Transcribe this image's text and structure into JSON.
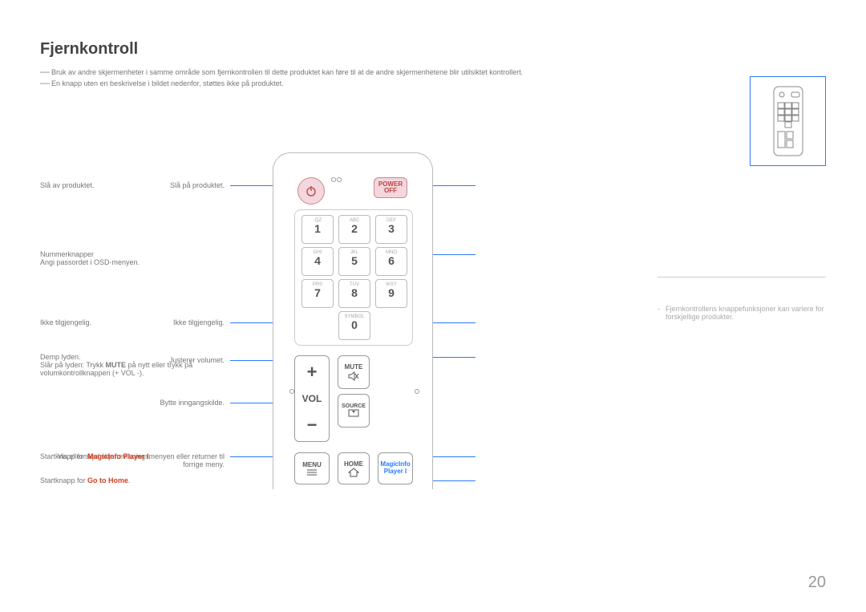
{
  "title": "Fjernkontroll",
  "note1": "Bruk av andre skjermenheter i samme område som fjernkontrollen til dette produktet kan føre til at de andre skjermenhetene blir utilsiktet kontrollert.",
  "note2": "En knapp uten en beskrivelse i bildet nedenfor, støttes ikke på produktet.",
  "sidenote": "Fjernkontrollens knappefunksjoner kan variere for forskjellige produkter.",
  "pagenum": "20",
  "remote": {
    "poweroff": "POWER OFF",
    "vol": "VOL",
    "mute": "MUTE",
    "source": "SOURCE",
    "menu": "MENU",
    "home": "HOME",
    "magicinfo": "MagicInfo Player I",
    "keys": [
      {
        "sub": ".QZ",
        "num": "1"
      },
      {
        "sub": "ABC",
        "num": "2"
      },
      {
        "sub": "DEF",
        "num": "3"
      },
      {
        "sub": "GHI",
        "num": "4"
      },
      {
        "sub": "JKL",
        "num": "5"
      },
      {
        "sub": "MNO",
        "num": "6"
      },
      {
        "sub": "PRS",
        "num": "7"
      },
      {
        "sub": "TUV",
        "num": "8"
      },
      {
        "sub": "WXY",
        "num": "9"
      },
      {
        "sub": "SYMBOL",
        "num": "0"
      }
    ]
  },
  "labels": {
    "l_power": "Slå på produktet.",
    "l_na1": "Ikke tilgjengelig.",
    "l_vol": "Justerer volumet.",
    "l_source": "Bytte inngangskilde.",
    "l_menu": "Vis eller skjul skjermvisningsmenyen eller returner til forrige meny.",
    "r_poweroff": "Slå av produktet.",
    "r_num1": "Nummerknapper",
    "r_num2": "Angi passordet i OSD-menyen.",
    "r_na2": "Ikke tilgjengelig.",
    "r_mute1": "Demp lyden.",
    "r_mute2a": "Slår på lyden: Trykk ",
    "r_mute2b": "MUTE",
    "r_mute2c": " på nytt eller trykk på volumkontrollknappen (+ VOL -).",
    "r_magic_pre": "Startknapp for ",
    "r_magic_hl": "MagicInfo Player I",
    "r_home_pre": "Startknapp for ",
    "r_home_hl": "Go to Home"
  }
}
